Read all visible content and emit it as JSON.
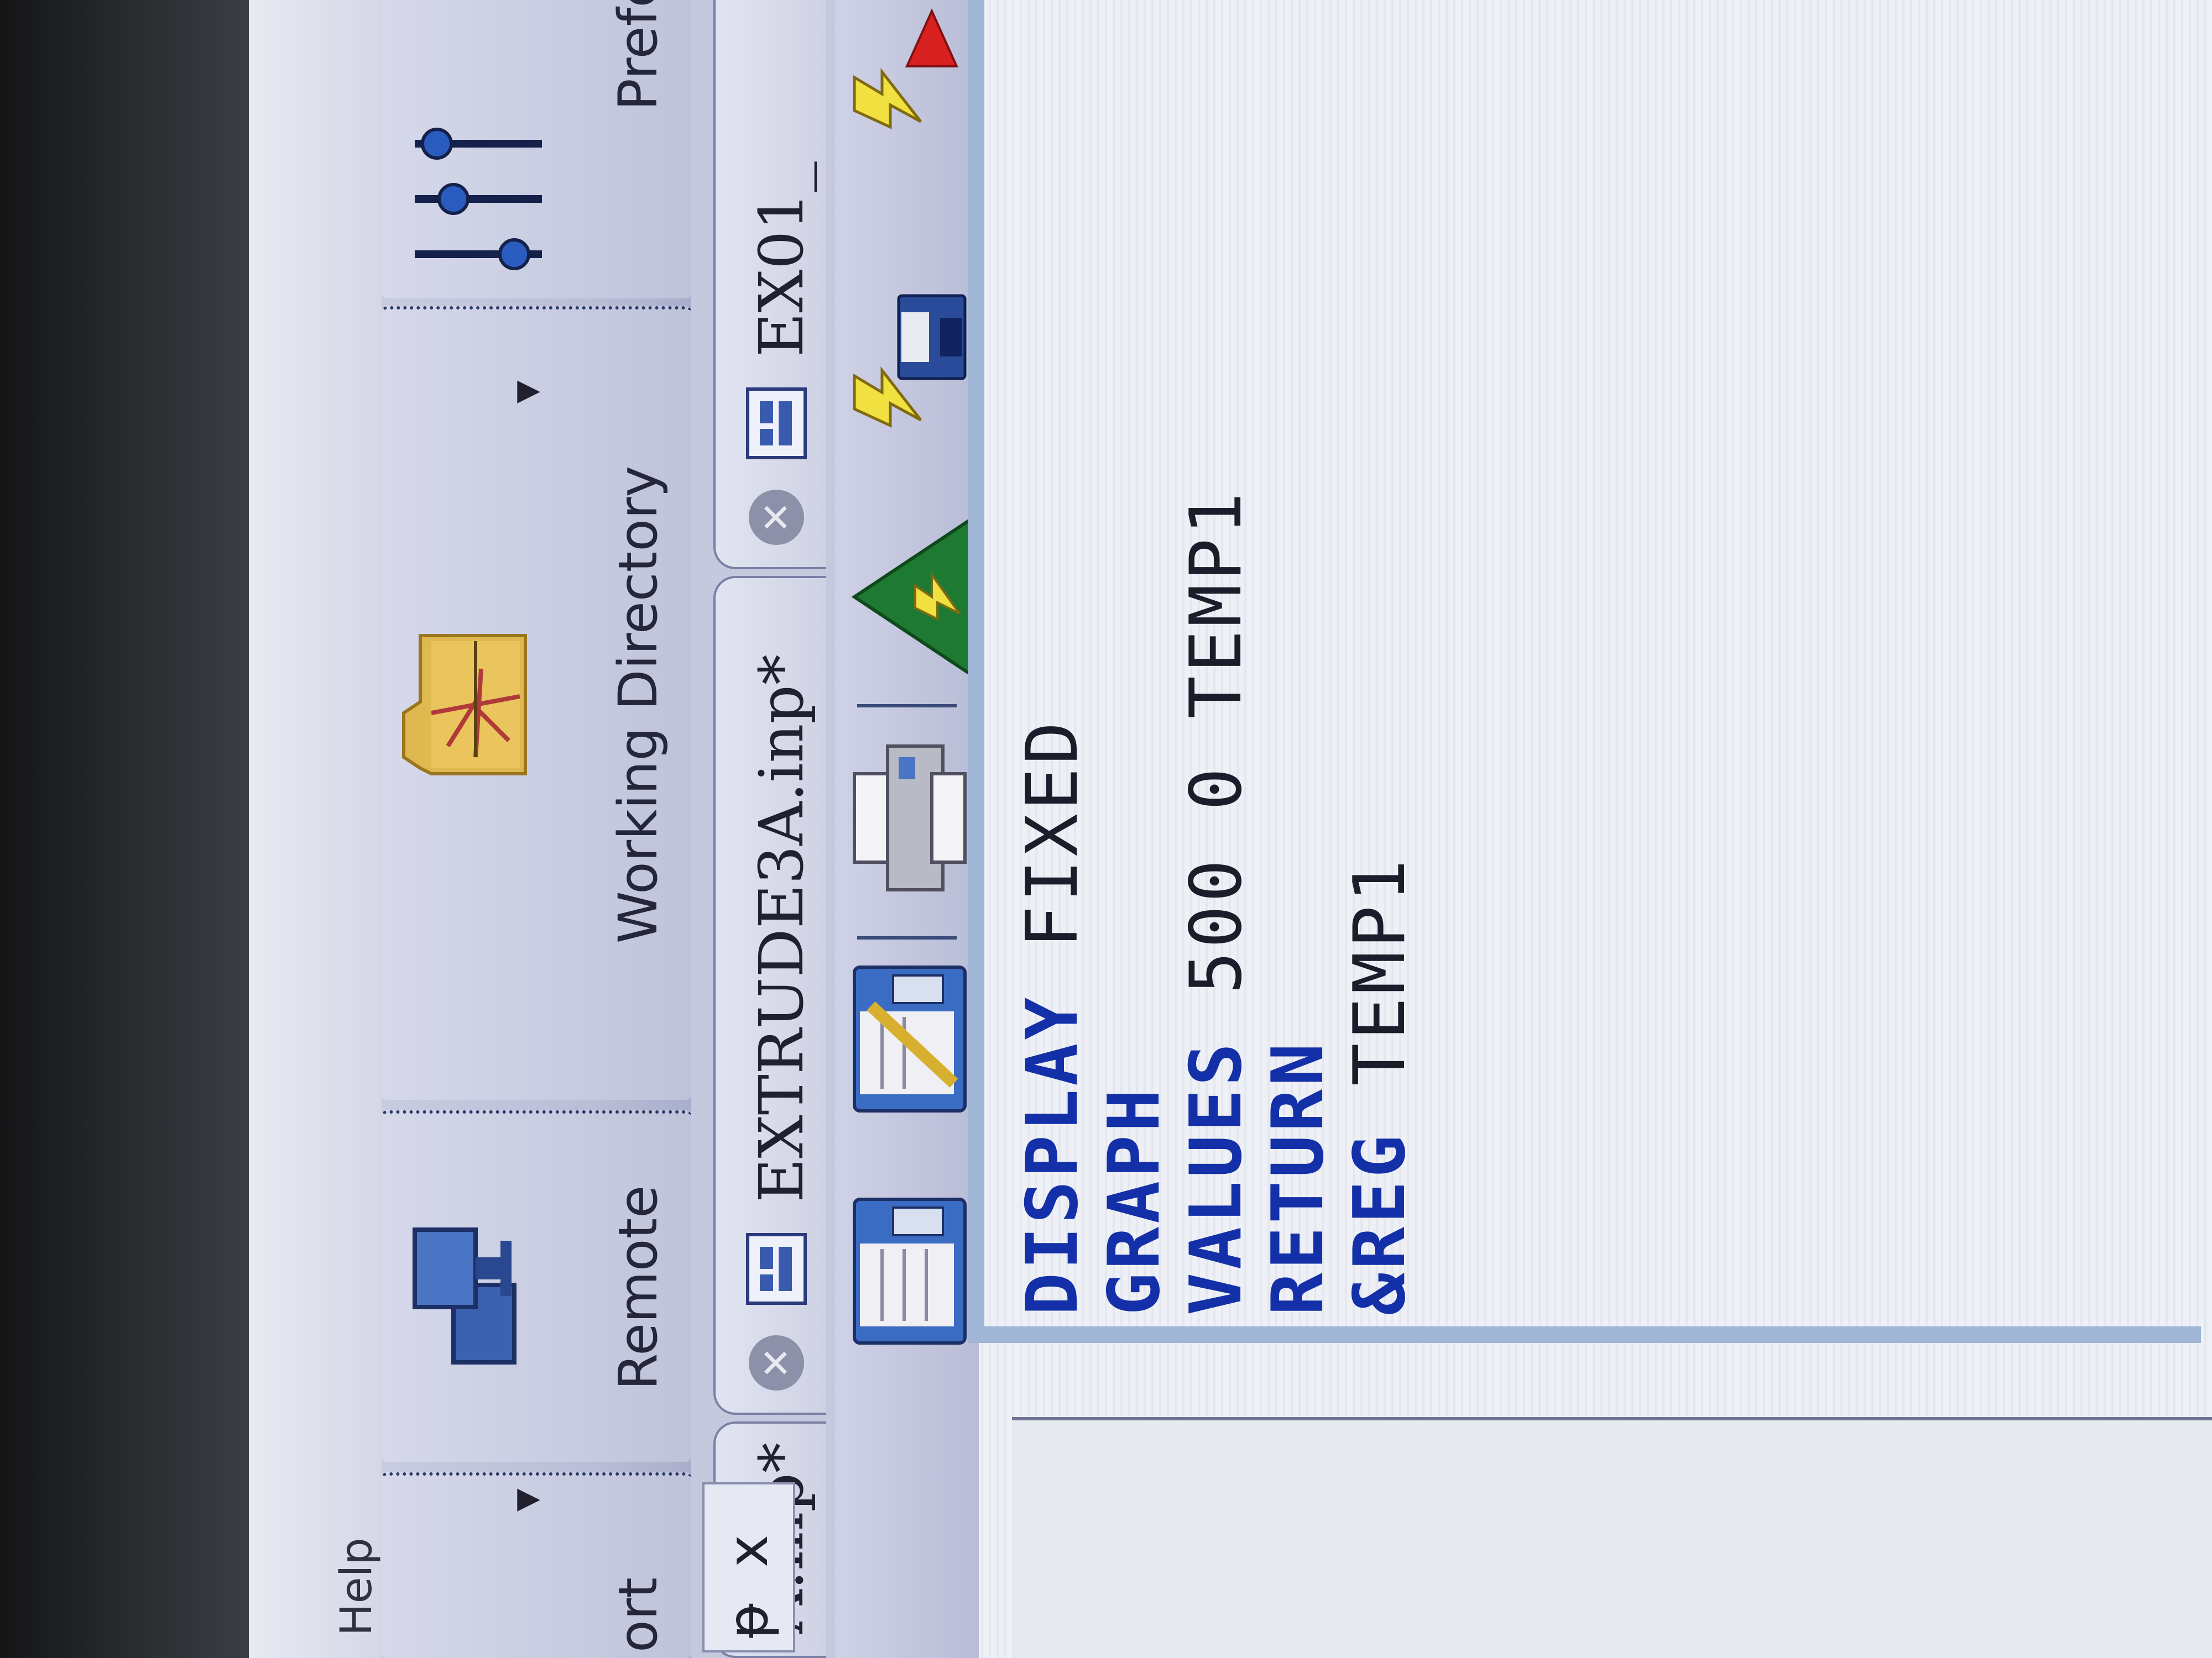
{
  "menu": {
    "help": "Help"
  },
  "ribbon": {
    "groups": [
      {
        "id": "import",
        "label": "ort",
        "has_dropdown": true
      },
      {
        "id": "remote",
        "label": "Remote",
        "icon": "monitors-icon"
      },
      {
        "id": "working-directory",
        "label": "Working Directory",
        "icon": "folder-icon",
        "has_dropdown": true
      },
      {
        "id": "preferences",
        "label": "Preferenc",
        "icon": "sliders-icon"
      }
    ]
  },
  "panel": {
    "pin": "ᵽ",
    "close": "x"
  },
  "tabs": [
    {
      "label": "A.inp*",
      "active": false
    },
    {
      "label": "EXTRUDE3A.inp*",
      "active": true
    },
    {
      "label": "EX01_",
      "active": false
    }
  ],
  "toolbar": {
    "icons": [
      "new-file-icon",
      "edit-file-icon",
      "print-icon",
      "run-model-icon",
      "run-icon",
      "save-icon",
      "run-again-icon",
      "flag-icon"
    ]
  },
  "editor": {
    "lines": [
      {
        "keyword": "DISPLAY",
        "args": " FIXED"
      },
      {
        "keyword": "GRAPH",
        "args": ""
      },
      {
        "keyword": "VALUES",
        "args": " 500 0 TEMP1"
      },
      {
        "keyword": "RETURN",
        "args": ""
      },
      {
        "keyword": "&REG",
        "args": " TEMP1"
      }
    ]
  }
}
